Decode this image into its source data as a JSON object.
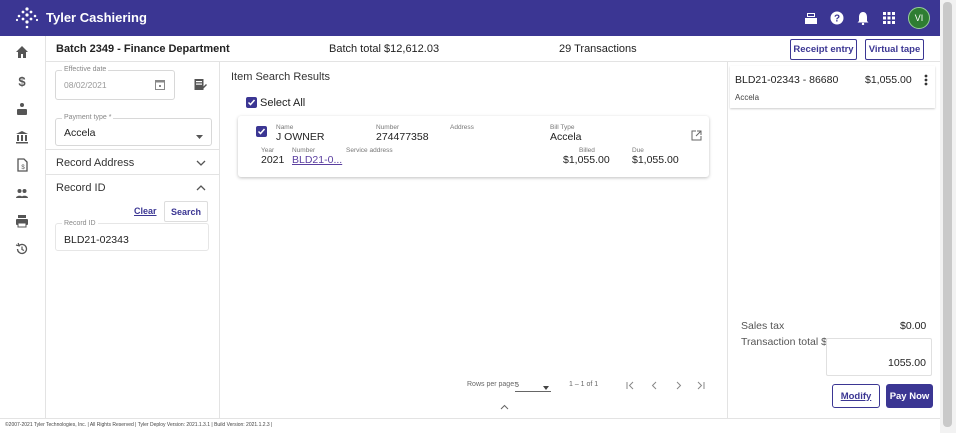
{
  "app": {
    "title": "Tyler Cashiering",
    "avatar_initials": "VI",
    "brand_color": "#3b3693"
  },
  "topbar_icons": [
    "cash-register-icon",
    "help-icon",
    "notification-bell-icon",
    "apps-grid-icon"
  ],
  "nav_icons": [
    "home-icon",
    "dollar-icon",
    "payment-icon",
    "bank-icon",
    "document-icon",
    "users-icon",
    "print-icon",
    "history-icon"
  ],
  "header": {
    "batch_name": "Batch 2349 - Finance Department",
    "batch_total": "Batch total $12,612.03",
    "transactions": "29 Transactions",
    "receipt_entry": "Receipt entry",
    "virtual_tape": "Virtual tape"
  },
  "left": {
    "effective_date_label": "Effective date",
    "effective_date_value": "08/02/2021",
    "payment_type_label": "Payment type *",
    "payment_type_value": "Accela",
    "record_address": "Record Address",
    "record_id": "Record ID",
    "clear": "Clear",
    "search": "Search",
    "record_id_field_label": "Record ID",
    "record_id_field_value": "BLD21-02343"
  },
  "results": {
    "title": "Item Search Results",
    "select_all": "Select All",
    "item": {
      "name_label": "Name",
      "name": "J OWNER",
      "number_label": "Number",
      "number": "274477358",
      "address_label": "Address",
      "bill_type_label": "Bill Type",
      "bill_type": "Accela",
      "year_label": "Year",
      "year": "2021",
      "record_number_label": "Number",
      "record_number": "BLD21-0...",
      "service_address_label": "Service address",
      "billed_label": "Billed",
      "billed": "$1,055.00",
      "due_label": "Due",
      "due": "$1,055.00"
    },
    "pager": {
      "rows_per_page_label": "Rows per page:",
      "rows_per_page": "5",
      "range": "1 – 1 of 1"
    }
  },
  "right": {
    "item_title": "BLD21-02343 - 86680",
    "item_amount": "$1,055.00",
    "item_subtitle": "Accela",
    "sales_tax_label": "Sales tax",
    "sales_tax": "$0.00",
    "transaction_total_label": "Transaction total $",
    "transaction_total": "1055.00",
    "modify": "Modify",
    "pay_now": "Pay Now"
  },
  "footer": {
    "text": "©2007-2021 Tyler Technologies, Inc. | All Rights Reserved | Tyler Deploy Version: 2021.1.3.1 | Build Version: 2021.1.2.3 |"
  }
}
